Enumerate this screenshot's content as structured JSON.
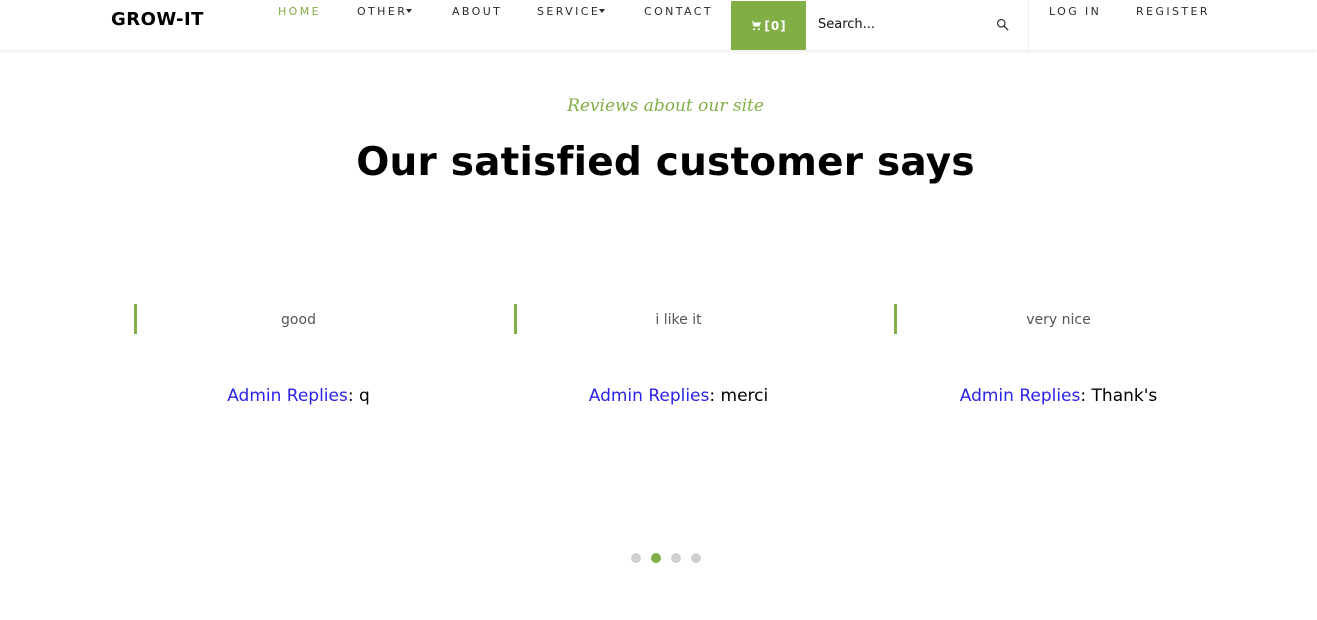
{
  "brand": "GROW-IT",
  "nav": {
    "home": "HOME",
    "other": "OTHER",
    "about": "ABOUT",
    "service": "SERVICE",
    "contact": "CONTACT",
    "login": "LOG IN",
    "register": "REGISTER"
  },
  "cart": {
    "label": "[0]"
  },
  "search": {
    "placeholder": "Search..."
  },
  "section": {
    "subheading": "Reviews about our site",
    "heading": "Our satisfied customer says"
  },
  "reviews": [
    {
      "text": "good",
      "reply_prefix": "Admin Replies",
      "reply": "q"
    },
    {
      "text": "i like it",
      "reply_prefix": "Admin Replies",
      "reply": "merci"
    },
    {
      "text": "very nice",
      "reply_prefix": "Admin Replies",
      "reply": "Thank's"
    }
  ],
  "carousel": {
    "total_dots": 4,
    "active_dot": 2
  },
  "colors": {
    "accent": "#82ae46",
    "admin_link": "#2b22e6",
    "dot_inactive": "#cfcfcf"
  }
}
